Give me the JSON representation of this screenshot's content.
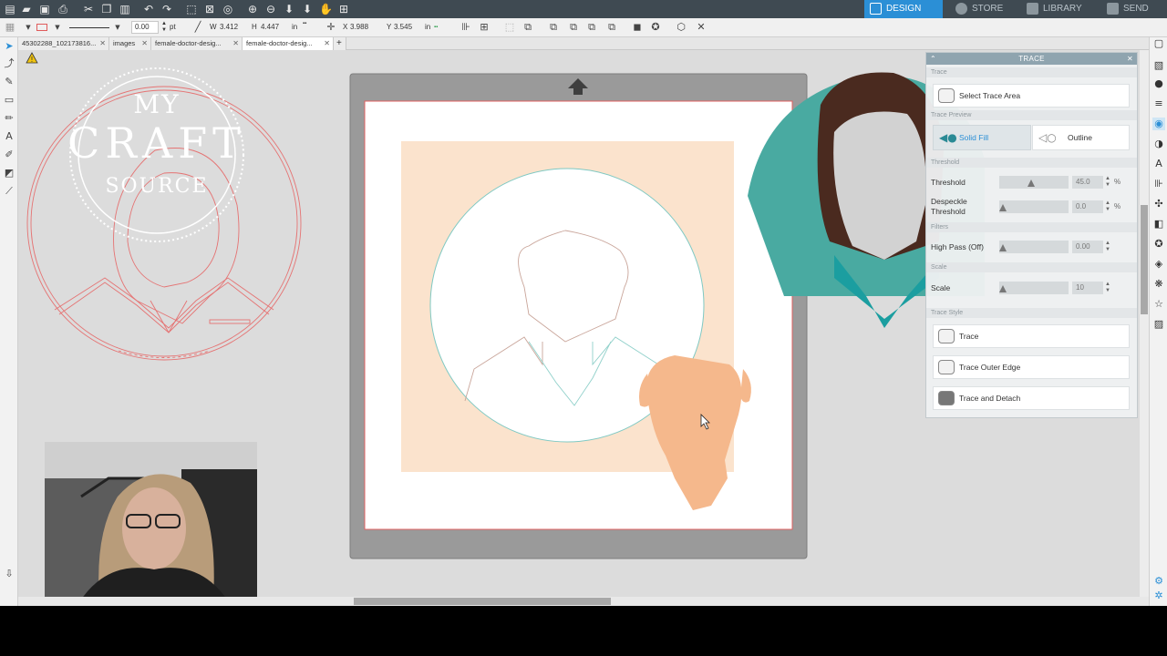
{
  "nav": {
    "tabs": [
      {
        "label": "DESIGN",
        "active": true
      },
      {
        "label": "STORE",
        "active": false
      },
      {
        "label": "LIBRARY",
        "active": false
      },
      {
        "label": "SEND",
        "active": false
      }
    ]
  },
  "toolbar": {
    "line_width": "0.00",
    "line_unit": "pt",
    "width_label": "W",
    "width_value": "3.412",
    "height_label": "H",
    "height_value": "4.447",
    "size_unit": "in",
    "x_label": "X",
    "x_value": "3.988",
    "y_label": "Y",
    "y_value": "3.545",
    "pos_unit": "in"
  },
  "doc_tabs": [
    {
      "label": "45302288_102173816...",
      "active": false
    },
    {
      "label": "images",
      "active": false
    },
    {
      "label": "female-doctor-desig...",
      "active": false
    },
    {
      "label": "female-doctor-desig...",
      "active": true
    }
  ],
  "watermark": {
    "line1": "MY",
    "line2": "CRAFT",
    "line3": "SOURCE"
  },
  "trace_panel": {
    "title": "TRACE",
    "section_trace": "Trace",
    "select_trace_area": "Select Trace Area",
    "section_preview": "Trace Preview",
    "solid_fill": "Solid Fill",
    "outline": "Outline",
    "section_threshold": "Threshold",
    "threshold_label": "Threshold",
    "threshold_value": "45.0",
    "threshold_level": 0.45,
    "threshold_unit": "%",
    "despeckle_label_1": "Despeckle",
    "despeckle_label_2": "Threshold",
    "despeckle_value": "0.0",
    "despeckle_level": 0,
    "despeckle_unit": "%",
    "section_filters": "Filters",
    "highpass_label": "High Pass (Off)",
    "highpass_value": "0.00",
    "highpass_level": 0,
    "section_scale": "Scale",
    "scale_label": "Scale",
    "scale_value": "10",
    "scale_level": 0,
    "section_style": "Trace Style",
    "trace_btn": "Trace",
    "trace_outer_btn": "Trace Outer Edge",
    "trace_detach_btn": "Trace and Detach"
  },
  "colors": {
    "accent": "#2b8fd6",
    "teal": "#3aa69e",
    "peach": "#f5b88c",
    "cut_line": "#e05b5b"
  }
}
